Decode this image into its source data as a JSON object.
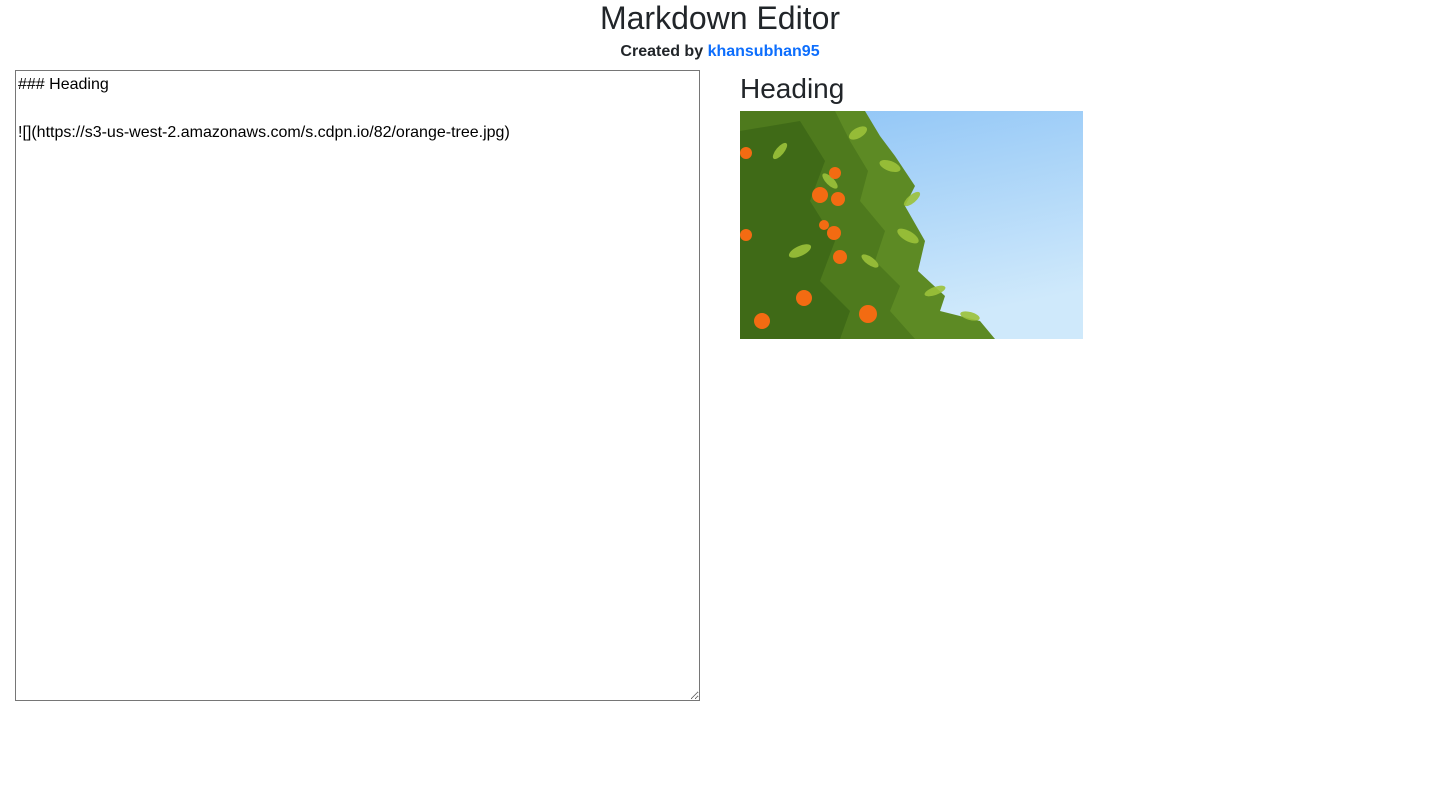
{
  "header": {
    "title": "Markdown Editor",
    "created_by_prefix": "Created by",
    "author_link": "khansubhan95"
  },
  "editor": {
    "value": "### Heading\n\n![](https://s3-us-west-2.amazonaws.com/s.cdpn.io/82/orange-tree.jpg)"
  },
  "preview": {
    "heading": "Heading",
    "image_alt": ""
  },
  "colors": {
    "link": "#0d6efd",
    "text": "#212529",
    "sky_top": "#8ec4f6",
    "sky_bottom": "#cfe9fb",
    "leaf": "#6f9a2a",
    "orange": "#f36b12"
  }
}
